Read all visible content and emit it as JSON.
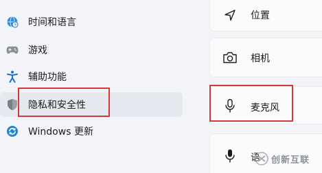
{
  "sidebar": {
    "items": [
      {
        "label": "时间和语言",
        "icon": "globe-clock-icon"
      },
      {
        "label": "游戏",
        "icon": "gamepad-icon"
      },
      {
        "label": "辅助功能",
        "icon": "accessibility-icon"
      },
      {
        "label": "隐私和安全性",
        "icon": "shield-icon",
        "selected": true
      },
      {
        "label": "Windows 更新",
        "icon": "windows-update-icon"
      }
    ]
  },
  "content": {
    "items": [
      {
        "label": "位置",
        "icon": "location-arrow-icon"
      },
      {
        "label": "相机",
        "icon": "camera-icon"
      },
      {
        "label": "麦克风",
        "icon": "microphone-icon"
      },
      {
        "label": "语",
        "icon": "microphone-icon"
      }
    ]
  },
  "watermark": {
    "text": "创新互联"
  },
  "colors": {
    "highlight": "#d5383a",
    "background": "#f2f4f8",
    "card": "#fbfbfc"
  }
}
